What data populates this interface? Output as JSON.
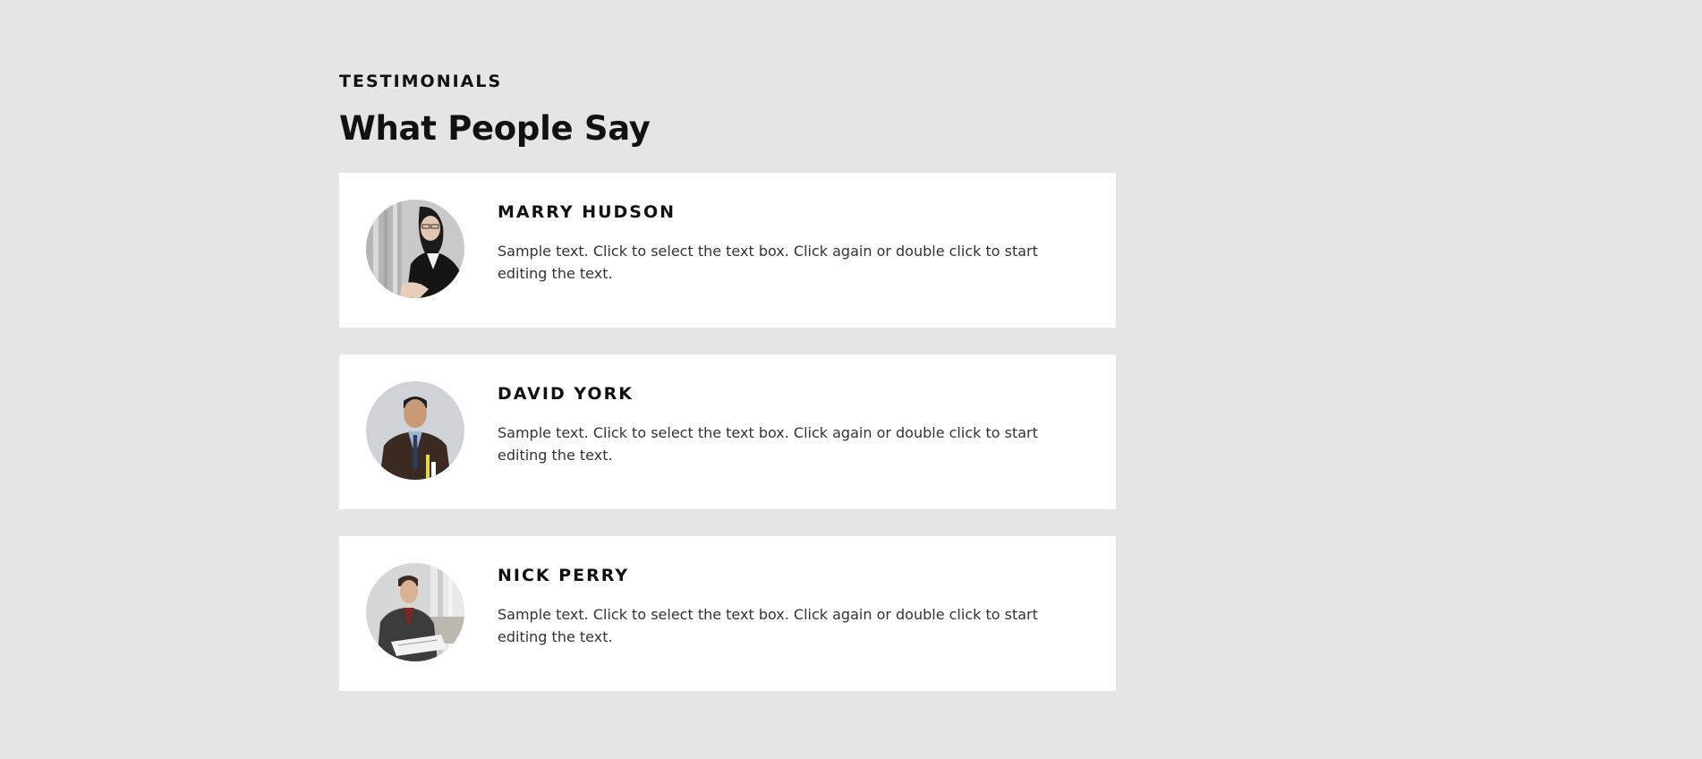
{
  "section": {
    "eyebrow": "TESTIMONIALS",
    "heading": "What People Say"
  },
  "testimonials": [
    {
      "name": "MARRY HUDSON",
      "text": "Sample text. Click to select the text box. Click again or double click to start editing the text.",
      "avatar": "woman-in-black-blazer-photo"
    },
    {
      "name": "DAVID YORK",
      "text": "Sample text. Click to select the text box. Click again or double click to start editing the text.",
      "avatar": "man-in-suit-photo"
    },
    {
      "name": "NICK PERRY",
      "text": "Sample text. Click to select the text box. Click again or double click to start editing the text.",
      "avatar": "man-reading-documents-photo"
    }
  ],
  "colors": {
    "background": "#e5e5e5",
    "card": "#ffffff",
    "heading_text": "#111111",
    "body_text": "#333333"
  }
}
